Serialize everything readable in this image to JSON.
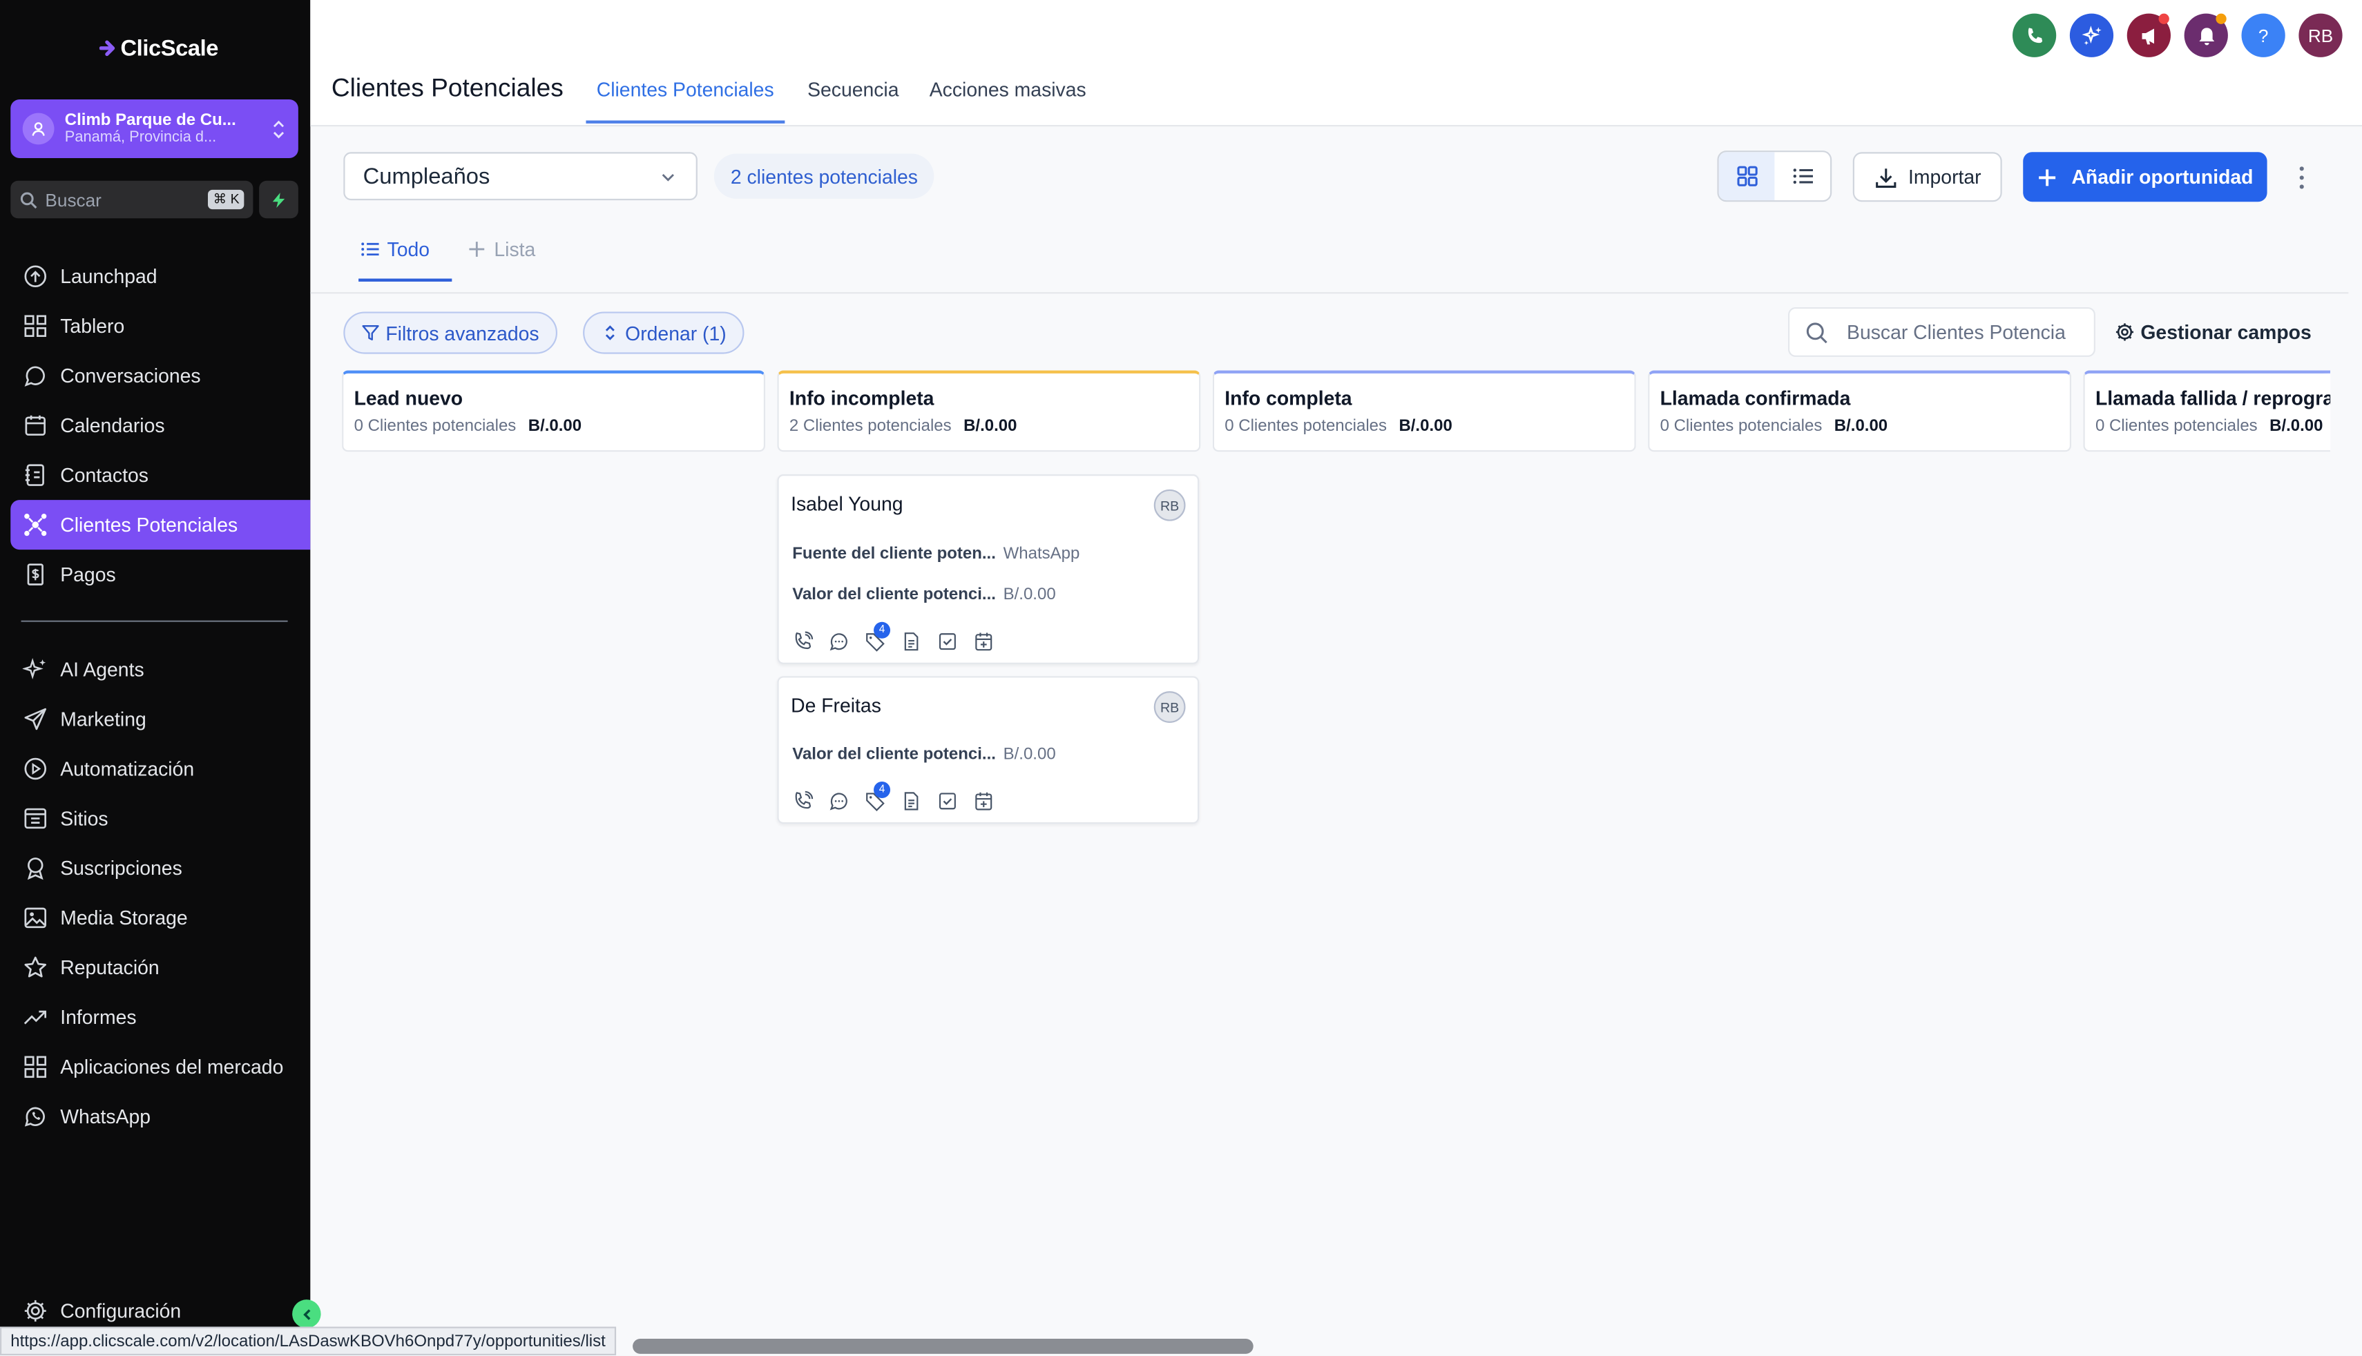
{
  "brand": {
    "name": "ClicScale",
    "accent": "#7b4ef4"
  },
  "account": {
    "name": "Climb Parque de Cu...",
    "location": "Panamá, Provincia d..."
  },
  "sidebar_search": {
    "placeholder": "Buscar",
    "shortcut": "⌘ K"
  },
  "sidebar": {
    "items": [
      {
        "label": "Launchpad",
        "icon": "launchpad-icon"
      },
      {
        "label": "Tablero",
        "icon": "dashboard-icon"
      },
      {
        "label": "Conversaciones",
        "icon": "chat-icon"
      },
      {
        "label": "Calendarios",
        "icon": "calendar-icon"
      },
      {
        "label": "Contactos",
        "icon": "contacts-icon"
      },
      {
        "label": "Clientes Potenciales",
        "icon": "opportunities-icon",
        "active": true
      },
      {
        "label": "Pagos",
        "icon": "payments-icon"
      }
    ],
    "items2": [
      {
        "label": "AI Agents",
        "icon": "sparkles-icon"
      },
      {
        "label": "Marketing",
        "icon": "send-icon"
      },
      {
        "label": "Automatización",
        "icon": "automation-icon"
      },
      {
        "label": "Sitios",
        "icon": "sites-icon"
      },
      {
        "label": "Suscripciones",
        "icon": "award-icon"
      },
      {
        "label": "Media Storage",
        "icon": "image-icon"
      },
      {
        "label": "Reputación",
        "icon": "star-icon"
      },
      {
        "label": "Informes",
        "icon": "trend-icon"
      },
      {
        "label": "Aplicaciones del mercado",
        "icon": "apps-icon"
      },
      {
        "label": "WhatsApp",
        "icon": "whatsapp-icon"
      }
    ],
    "settings": "Configuración"
  },
  "header": {
    "title": "Clientes Potenciales",
    "tabs": [
      "Clientes Potenciales",
      "Secuencia",
      "Acciones masivas"
    ],
    "user_initials": "RB",
    "icon_colors": {
      "phone": "#2e8b57",
      "ai": "#2c5ce0",
      "megaphone": "#8b1e3f",
      "bell": "#6b2d6e",
      "help": "#3b82f6",
      "avatar": "#7a2a55"
    }
  },
  "toolbar": {
    "pipeline": "Cumpleaños",
    "count": "2 clientes potenciales",
    "import": "Importar",
    "add": "Añadir oportunidad"
  },
  "view_tabs": {
    "all": "Todo",
    "list": "Lista"
  },
  "filters": {
    "advanced": "Filtros avanzados",
    "sort": "Ordenar (1)",
    "search_placeholder": "Buscar Clientes Potencia",
    "manage_fields": "Gestionar campos"
  },
  "columns": [
    {
      "title": "Lead nuevo",
      "count": "0 Clientes potenciales",
      "amount": "B/.0.00",
      "color": "#4f8ff7"
    },
    {
      "title": "Info incompleta",
      "count": "2 Clientes potenciales",
      "amount": "B/.0.00",
      "color": "#f5c14b"
    },
    {
      "title": "Info completa",
      "count": "0 Clientes potenciales",
      "amount": "B/.0.00",
      "color": "#8fa3f5"
    },
    {
      "title": "Llamada confirmada",
      "count": "0 Clientes potenciales",
      "amount": "B/.0.00",
      "color": "#8fa3f5"
    },
    {
      "title": "Llamada fallida / reprogra",
      "count": "0 Clientes potenciales",
      "amount": "B/.0.00",
      "color": "#8fa3f5"
    }
  ],
  "cards": [
    {
      "name": "Isabel Young",
      "owner": "RB",
      "fields": [
        {
          "label": "Fuente del cliente poten...",
          "value": "WhatsApp"
        },
        {
          "label": "Valor del cliente potenci...",
          "value": "B/.0.00"
        }
      ],
      "tag_count": "4"
    },
    {
      "name": "De Freitas",
      "owner": "RB",
      "fields": [
        {
          "label": "Valor del cliente potenci...",
          "value": "B/.0.00"
        }
      ],
      "tag_count": "4"
    }
  ],
  "status_url": "https://app.clicscale.com/v2/location/LAsDaswKBOVh6Onpd77y/opportunities/list"
}
